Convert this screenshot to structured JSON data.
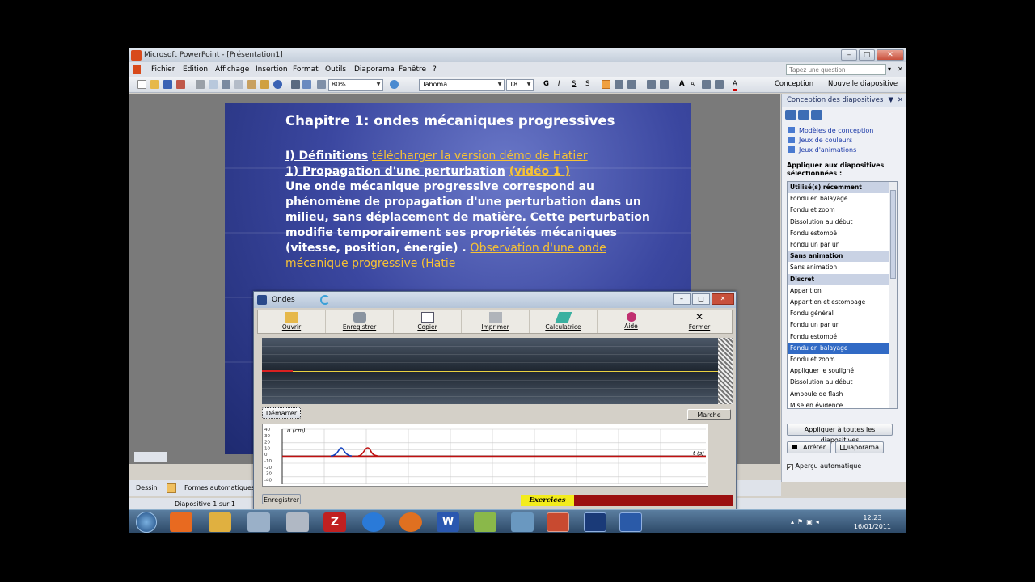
{
  "window": {
    "title": "Microsoft PowerPoint - [Présentation1]"
  },
  "menu": [
    "Fichier",
    "Edition",
    "Affichage",
    "Insertion",
    "Format",
    "Outils",
    "Diaporama",
    "Fenêtre",
    "?"
  ],
  "ask": {
    "placeholder": "Tapez une question"
  },
  "toolbar": {
    "zoom": "80%",
    "font": "Tahoma",
    "size": "18",
    "bold": "G",
    "italic": "I",
    "underline": "S",
    "shadow": "S",
    "conception": "Conception",
    "new_slide": "Nouvelle diapositive"
  },
  "slide": {
    "title": "Chapitre 1: ondes mécaniques progressives",
    "sec1": "I) Définitions",
    "sec1_link": "télécharger la version démo de Hatier",
    "sub1": "1) Propagation d'une perturbation",
    "sub1_link": "(vidéo 1 )",
    "p1": "Une onde mécanique progressive correspond au",
    "p2": "phénomène de propagation d'une perturbation dans un",
    "p3": "milieu, sans déplacement de matière. Cette perturbation",
    "p4": "modifie temporairement ses propriétés mécaniques",
    "p5": "(vitesse, position, énergie) .",
    "p5_link": "Observation d'une onde",
    "p6_link": "mécanique progressive (Hatie"
  },
  "taskpane": {
    "title": "Conception des diapositives",
    "links": [
      "Modèles de conception",
      "Jeux de couleurs",
      "Jeux d'animations"
    ],
    "apply_label": "Appliquer aux diapositives sélectionnées :",
    "items": [
      {
        "t": "Utilisé(s) récemment",
        "k": "hd"
      },
      {
        "t": "Fondu en balayage",
        "k": ""
      },
      {
        "t": "Fondu et zoom",
        "k": ""
      },
      {
        "t": "Dissolution au début",
        "k": ""
      },
      {
        "t": "Fondu estompé",
        "k": ""
      },
      {
        "t": "Fondu un par un",
        "k": ""
      },
      {
        "t": "Sans animation",
        "k": "hd"
      },
      {
        "t": "Sans animation",
        "k": ""
      },
      {
        "t": "Discret",
        "k": "hd"
      },
      {
        "t": "Apparition",
        "k": ""
      },
      {
        "t": "Apparition et estompage",
        "k": ""
      },
      {
        "t": "Fondu général",
        "k": ""
      },
      {
        "t": "Fondu un par un",
        "k": ""
      },
      {
        "t": "Fondu estompé",
        "k": ""
      },
      {
        "t": "Fondu en balayage",
        "k": "sel"
      },
      {
        "t": "Fondu et zoom",
        "k": ""
      },
      {
        "t": "Appliquer le souligné",
        "k": ""
      },
      {
        "t": "Dissolution au début",
        "k": ""
      },
      {
        "t": "Ampoule de flash",
        "k": ""
      },
      {
        "t": "Mise en évidence",
        "k": ""
      }
    ],
    "apply_all": "Appliquer à toutes les diapositives",
    "stop": "Arrêter",
    "slideshow": "Diaporama",
    "autopreview": "Aperçu automatique"
  },
  "drawbar": {
    "draw": "Dessin",
    "shapes": "Formes automatiques"
  },
  "status": {
    "slide": "Diapositive 1 sur 1"
  },
  "ondes": {
    "title": "Ondes",
    "tools": [
      "Ouvrir",
      "Enregistrer",
      "Copier",
      "Imprimer",
      "Calculatrice",
      "Aide",
      "Fermer"
    ],
    "start": "Démarrer",
    "mode": "Marche",
    "y_label": "u (cm)",
    "x_label": "t (s)",
    "y_ticks": [
      "40",
      "30",
      "20",
      "10",
      "0",
      "-10",
      "-20",
      "-30",
      "-40"
    ],
    "save": "Enregistrer",
    "exercises": "Exercices"
  },
  "clock": {
    "time": "12:23",
    "date": "16/01/2011"
  }
}
